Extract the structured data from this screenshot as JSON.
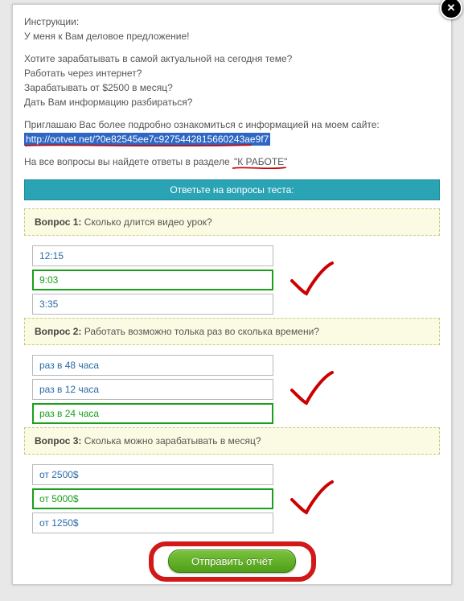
{
  "intro": {
    "heading": "Инструкции:",
    "line1": "У меня к Вам деловое предложение!",
    "q1": "Хотите зарабатывать в самой актуальной на сегодня теме?",
    "q2": "Работать через интернет?",
    "q3": "Зарабатывать от $2500 в месяц?",
    "q4": "Дать Вам информацию разбираться?",
    "invite": "Приглашаю Вас более подробно ознакомиться с информацией на моем сайте:",
    "link": "http://ootvet.net/?0e82545ee7c9275442815660243ae9f7",
    "section_prefix": "На все вопросы вы найдете ответы в разделе ",
    "section_quoted": "\"К РАБОТЕ\""
  },
  "quiz": {
    "header": "Ответьте на вопросы теста:",
    "questions": [
      {
        "label": "Вопрос 1:",
        "text": " Сколько длится видео урок?",
        "answers": [
          "12:15",
          "9:03",
          "3:35"
        ],
        "selected": 1
      },
      {
        "label": "Вопрос 2:",
        "text": " Работать возможно толька раз во сколька времени?",
        "answers": [
          "раз в 48 часа",
          "раз в 12 часа",
          "раз в 24 часа"
        ],
        "selected": 2
      },
      {
        "label": "Вопрос 3:",
        "text": " Сколька можно зарабатывать в месяц?",
        "answers": [
          "от 2500$",
          "от 5000$",
          "от 1250$"
        ],
        "selected": 1
      }
    ],
    "submit": "Отправить отчёт"
  },
  "close_glyph": "✕"
}
